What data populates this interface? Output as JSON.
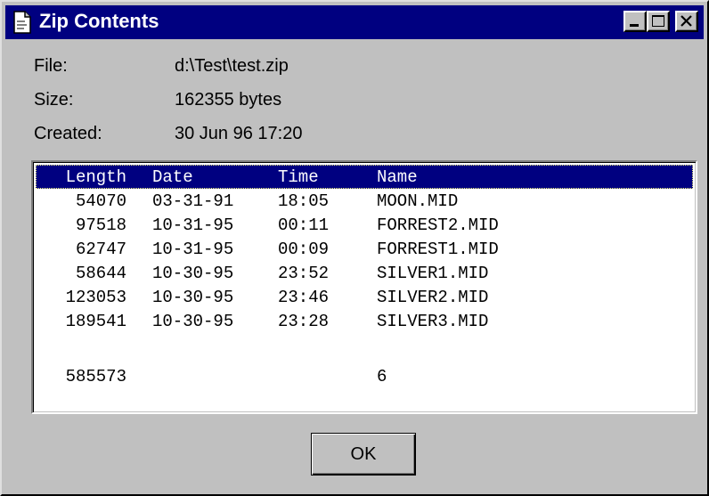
{
  "window": {
    "title": "Zip Contents",
    "title_icon": "document-icon",
    "controls": [
      "minimize",
      "maximize",
      "close"
    ]
  },
  "info": {
    "file_label": "File:",
    "file_value": "d:\\Test\\test.zip",
    "size_label": "Size:",
    "size_value": "162355 bytes",
    "created_label": "Created:",
    "created_value": "30 Jun 96  17:20"
  },
  "list": {
    "columns": [
      "Length",
      "Date",
      "Time",
      "Name"
    ],
    "rows": [
      [
        "54070",
        "03-31-91",
        "18:05",
        "MOON.MID"
      ],
      [
        "97518",
        "10-31-95",
        "00:11",
        "FORREST2.MID"
      ],
      [
        "62747",
        "10-31-95",
        "00:09",
        "FORREST1.MID"
      ],
      [
        "58644",
        "10-30-95",
        "23:52",
        "SILVER1.MID"
      ],
      [
        "123053",
        "10-30-95",
        "23:46",
        "SILVER2.MID"
      ],
      [
        "189541",
        "10-30-95",
        "23:28",
        "SILVER3.MID"
      ]
    ],
    "total_length": "585573",
    "total_count": "6"
  },
  "buttons": {
    "ok_label": "OK"
  },
  "colors": {
    "titlebar": "#000080",
    "face": "#c0c0c0",
    "selection": "#000080"
  }
}
